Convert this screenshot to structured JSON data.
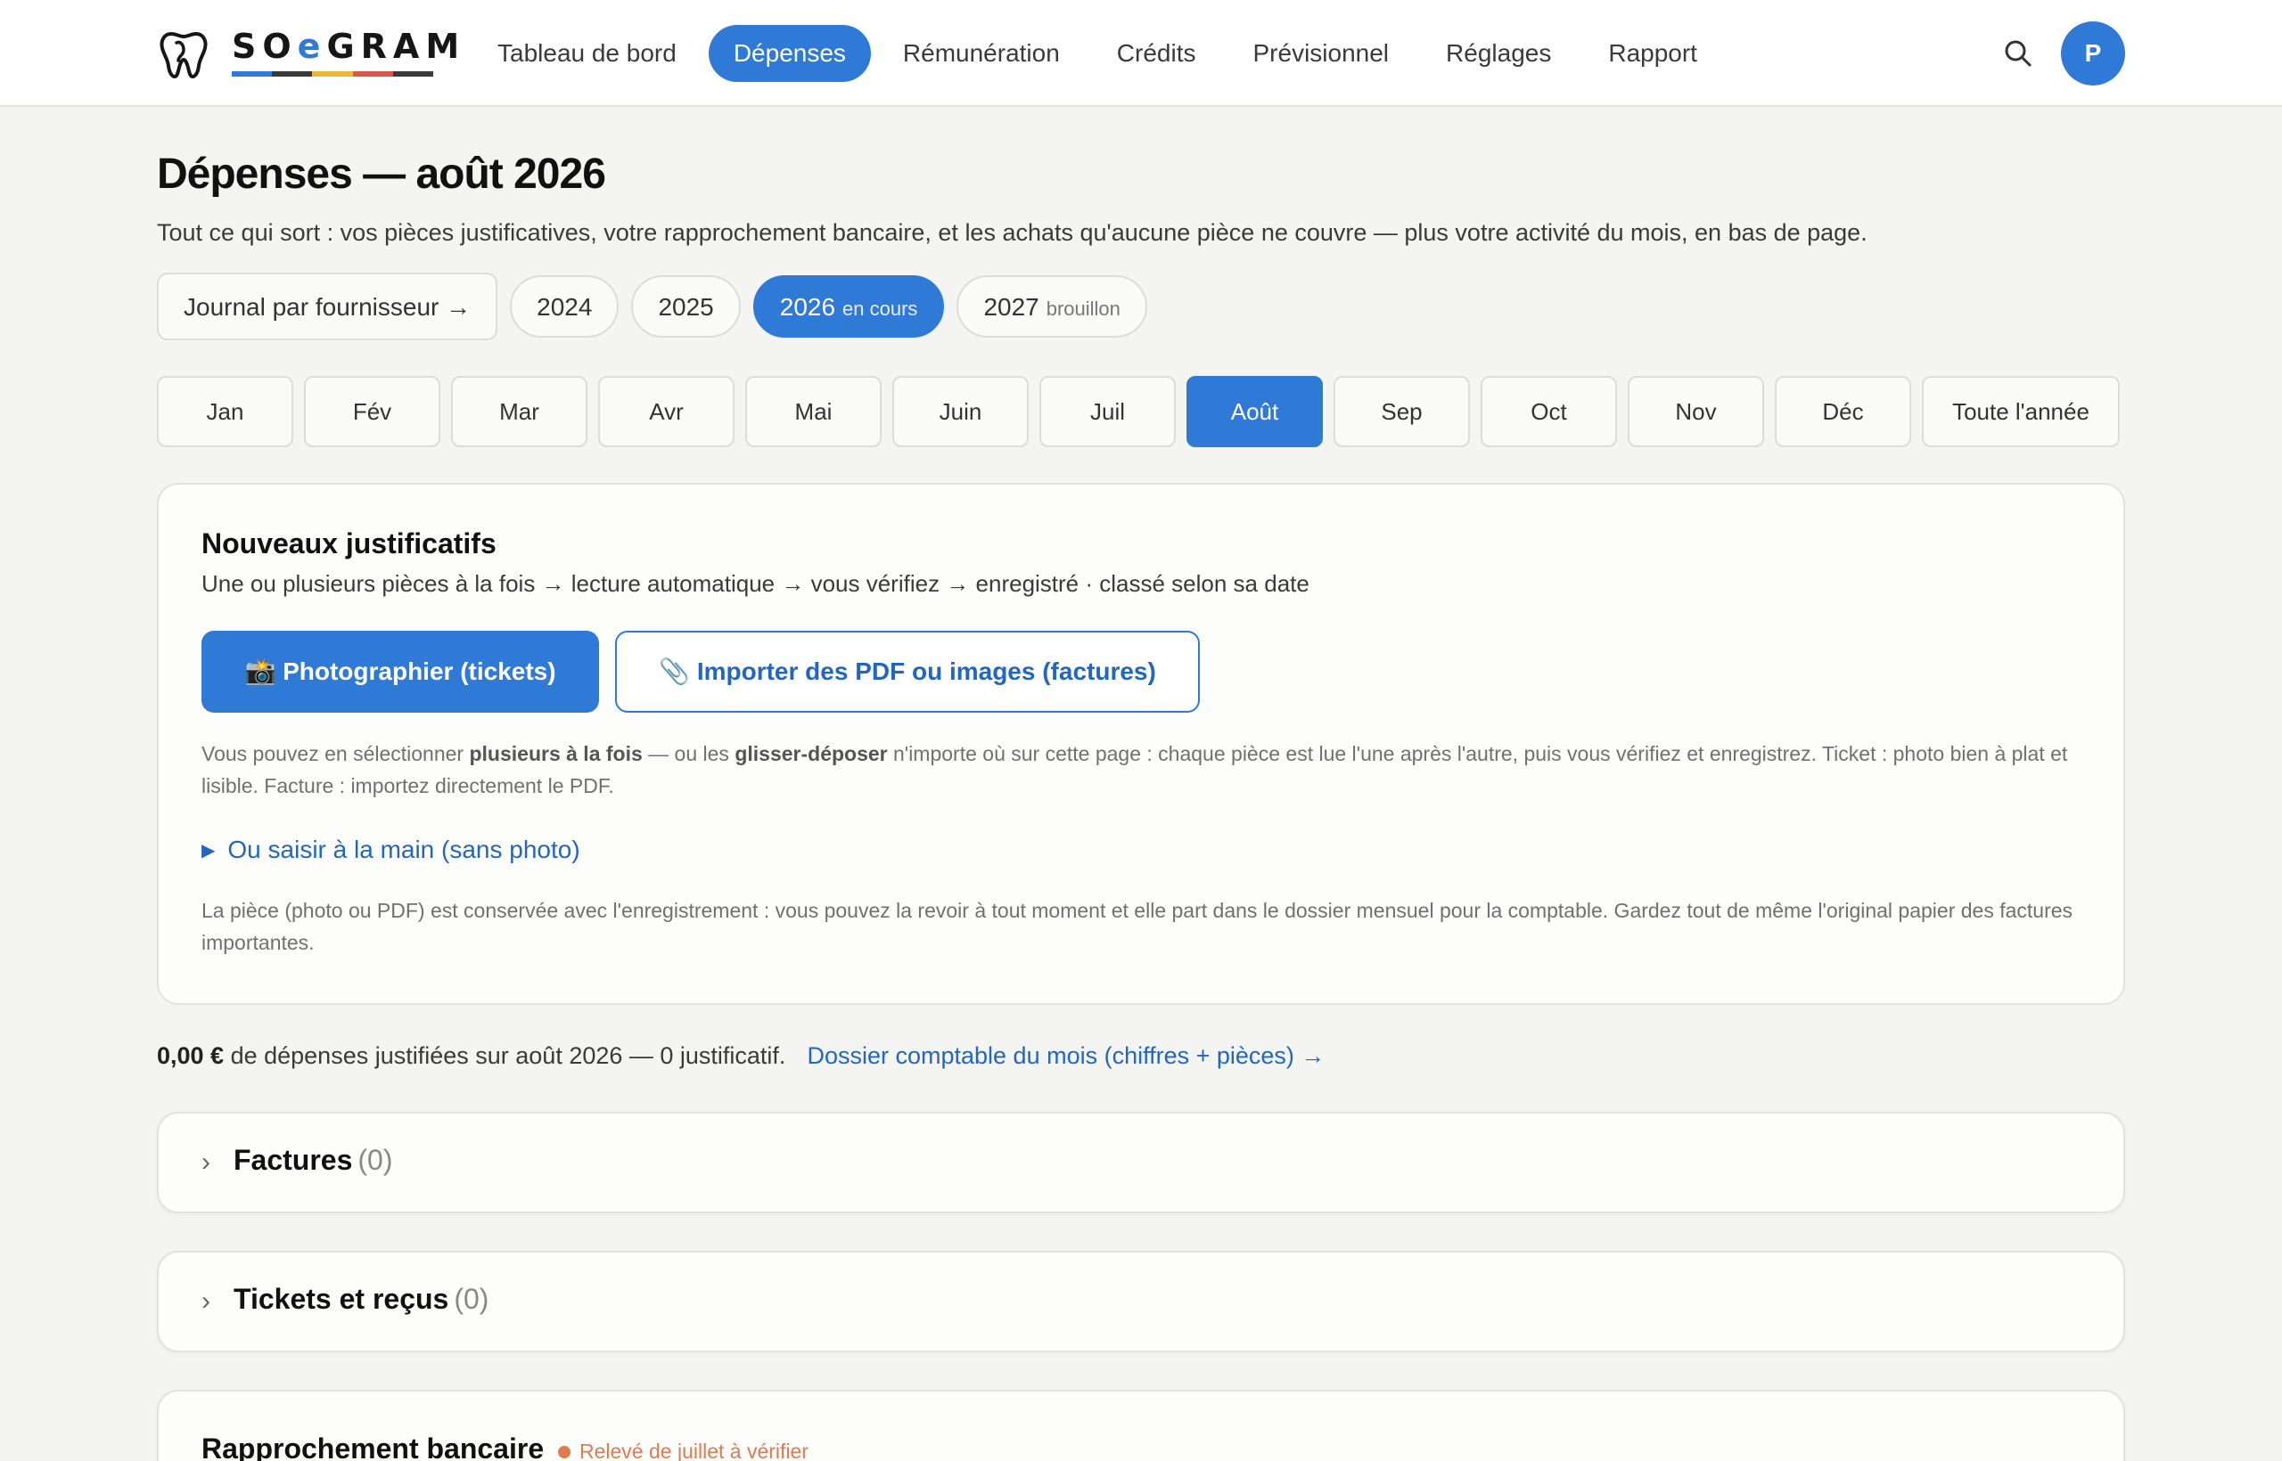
{
  "brand": {
    "prefix": "SO",
    "accent": "e",
    "suffix": "GRAM",
    "bar_colors": [
      "#2f7ad6",
      "#3a3a3a",
      "#e8b83b",
      "#d8584b",
      "#3a3a3a"
    ]
  },
  "nav": {
    "items": [
      {
        "label": "Tableau de bord"
      },
      {
        "label": "Dépenses",
        "active": true
      },
      {
        "label": "Rémunération"
      },
      {
        "label": "Crédits"
      },
      {
        "label": "Prévisionnel"
      },
      {
        "label": "Réglages"
      },
      {
        "label": "Rapport"
      }
    ],
    "avatar_initial": "P",
    "search_icon": "search-icon"
  },
  "page": {
    "title": "Dépenses — août 2026",
    "subtitle": "Tout ce qui sort : vos pièces justificatives, votre rapprochement bancaire, et les achats qu'aucune pièce ne couvre — plus votre activité du mois, en bas de page."
  },
  "years": {
    "journal_label": "Journal par fournisseur →",
    "items": [
      {
        "label": "2024",
        "tag": ""
      },
      {
        "label": "2025",
        "tag": ""
      },
      {
        "label": "2026",
        "tag": "en cours",
        "active": true
      },
      {
        "label": "2027",
        "tag": "brouillon"
      }
    ]
  },
  "months": {
    "items": [
      "Jan",
      "Fév",
      "Mar",
      "Avr",
      "Mai",
      "Juin",
      "Juil",
      "Août",
      "Sep",
      "Oct",
      "Nov",
      "Déc"
    ],
    "active": "Août",
    "all_year": "Toute l'année"
  },
  "upload": {
    "title": "Nouveaux justificatifs",
    "steps": "Une ou plusieurs pièces à la fois → lecture automatique → vous vérifiez → enregistré · classé selon sa date",
    "photo_button": "📸 Photographier (tickets)",
    "import_button": "📎 Importer des PDF ou images (factures)",
    "help_a": "Vous pouvez en sélectionner ",
    "help_b": "plusieurs à la fois",
    "help_c": " — ou les ",
    "help_d": "glisser-déposer",
    "help_e": " n'importe où sur cette page : chaque pièce est lue l'une après l'autre, puis vous vérifiez et enregistrez. Ticket : photo bien à plat et lisible. Facture : importez directement le PDF.",
    "manual_link": "Ou saisir à la main (sans photo)",
    "note": "La pièce (photo ou PDF) est conservée avec l'enregistrement : vous pouvez la revoir à tout moment et elle part dans le dossier mensuel pour la comptable. Gardez tout de même l'original papier des factures importantes."
  },
  "summary": {
    "amount": "0,00 €",
    "text": " de dépenses justifiées sur août 2026 — 0 justificatif.",
    "link": "Dossier comptable du mois (chiffres + pièces) →"
  },
  "sections": {
    "factures": {
      "title": "Factures",
      "count": "(0)"
    },
    "tickets": {
      "title": "Tickets et reçus",
      "count": "(0)"
    },
    "bank": {
      "title": "Rapprochement bancaire",
      "status": "Relevé de juillet à vérifier"
    }
  },
  "colors": {
    "accent": "#2f7ad6",
    "link": "#2366c0",
    "warning": "#e07a4f",
    "background": "#f4f4f3"
  }
}
